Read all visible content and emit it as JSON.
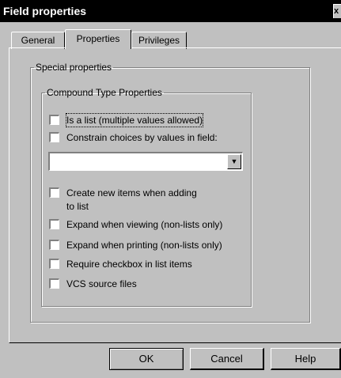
{
  "window": {
    "title": "Field properties",
    "close_glyph": "x"
  },
  "tabs": [
    {
      "label": "General",
      "active": false
    },
    {
      "label": "Properties",
      "active": true
    },
    {
      "label": "Privileges",
      "active": false
    }
  ],
  "special_group": {
    "label": "Special properties"
  },
  "compound_group": {
    "label": "Compound Type Properties",
    "is_list": {
      "label": "Is a list (multiple values allowed)",
      "checked": false
    },
    "constrain": {
      "label": "Constrain choices by values in field:",
      "checked": false
    },
    "field_combo": {
      "value": ""
    },
    "options": [
      {
        "label_line1": "Create new items when adding",
        "label_line2": "to list",
        "checked": false
      },
      {
        "label_line1": "Expand when viewing (non-lists only)",
        "label_line2": "",
        "checked": false
      },
      {
        "label_line1": "Expand when printing (non-lists only)",
        "label_line2": "",
        "checked": false
      },
      {
        "label_line1": "Require checkbox in list items",
        "label_line2": "",
        "checked": false
      },
      {
        "label_line1": "VCS source files",
        "label_line2": "",
        "checked": false
      }
    ]
  },
  "buttons": {
    "ok": "OK",
    "cancel": "Cancel",
    "help": "Help"
  }
}
